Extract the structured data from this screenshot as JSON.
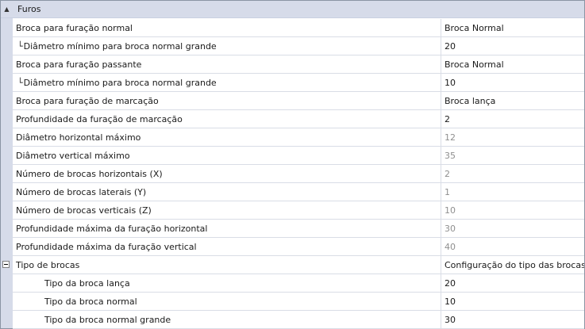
{
  "category": {
    "title": "Furos",
    "toggle_glyph": "▲"
  },
  "rows": [
    {
      "name": "Broca para furação normal",
      "value": "Broca Normal",
      "indent": 0,
      "disabled": false
    },
    {
      "name": "Diâmetro mínimo para broca normal grande",
      "value": "20",
      "indent": 1,
      "disabled": false
    },
    {
      "name": "Broca para furação passante",
      "value": "Broca Normal",
      "indent": 0,
      "disabled": false
    },
    {
      "name": "Diâmetro mínimo para broca normal grande",
      "value": "10",
      "indent": 1,
      "disabled": false
    },
    {
      "name": "Broca para furação de marcação",
      "value": "Broca lança",
      "indent": 0,
      "disabled": false
    },
    {
      "name": "Profundidade da furação de marcação",
      "value": "2",
      "indent": 0,
      "disabled": false
    },
    {
      "name": "Diâmetro horizontal máximo",
      "value": "12",
      "indent": 0,
      "disabled": true
    },
    {
      "name": "Diâmetro vertical máximo",
      "value": "35",
      "indent": 0,
      "disabled": true
    },
    {
      "name": "Número de brocas horizontais (X)",
      "value": "2",
      "indent": 0,
      "disabled": true
    },
    {
      "name": "Número de brocas laterais (Y)",
      "value": "1",
      "indent": 0,
      "disabled": true
    },
    {
      "name": "Número de brocas verticais (Z)",
      "value": "10",
      "indent": 0,
      "disabled": true
    },
    {
      "name": "Profundidade máxima da furação horizontal",
      "value": "30",
      "indent": 0,
      "disabled": true
    },
    {
      "name": "Profundidade máxima da furação vertical",
      "value": "40",
      "indent": 0,
      "disabled": true
    },
    {
      "name": "Tipo de brocas",
      "value": "Configuração do tipo das brocas.",
      "indent": 0,
      "disabled": false,
      "expanded": true
    },
    {
      "name": "Tipo da broca lança",
      "value": "20",
      "indent": 2,
      "disabled": false
    },
    {
      "name": "Tipo da broca normal",
      "value": "10",
      "indent": 2,
      "disabled": false
    },
    {
      "name": "Tipo da broca normal grande",
      "value": "30",
      "indent": 2,
      "disabled": false
    }
  ]
}
